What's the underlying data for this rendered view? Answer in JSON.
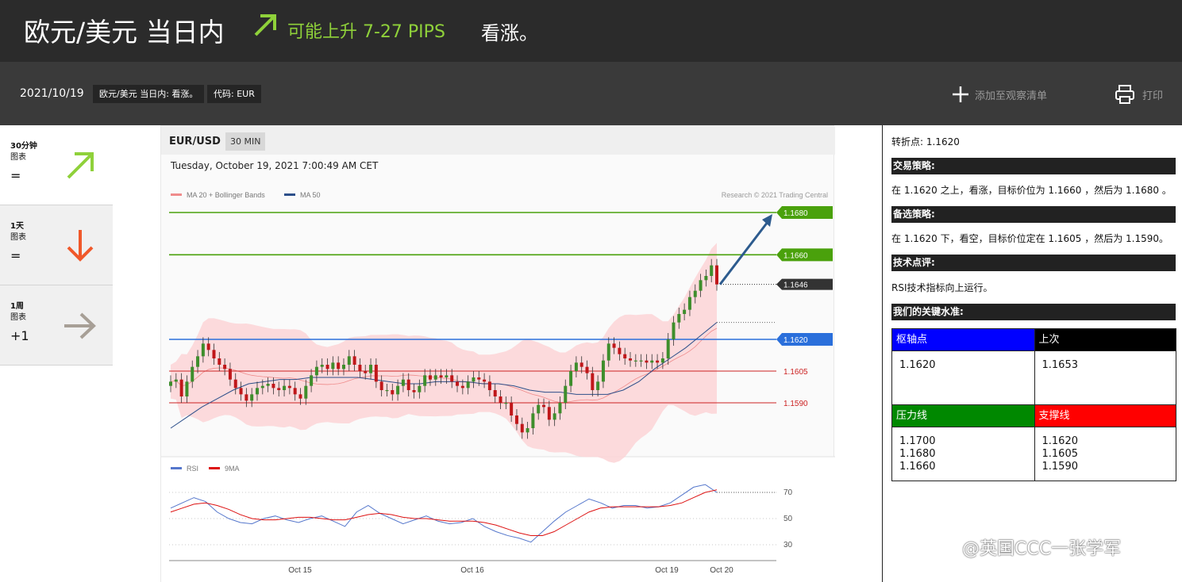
{
  "header": {
    "title": "欧元/美元 当日内",
    "forecast": "可能上升 7-27 PIPS",
    "bias": "看涨。",
    "arrow_color": "#8fd13a",
    "icon": "trend-up-arrow-icon"
  },
  "subheader": {
    "date": "2021/10/19",
    "tags": [
      "欧元/美元 当日内: 看涨。",
      "代码: EUR"
    ],
    "watchlist_label": "添加至观察清单",
    "print_label": "打印"
  },
  "timeframes": [
    {
      "label": "30分钟",
      "sublabel": "图表",
      "signal": "=",
      "direction": "up",
      "color": "#8fd13a"
    },
    {
      "label": "1天",
      "sublabel": "图表",
      "signal": "=",
      "direction": "down",
      "color": "#f0582a"
    },
    {
      "label": "1周",
      "sublabel": "图表",
      "signal": "+1",
      "direction": "right",
      "color": "#a79f96"
    }
  ],
  "chart": {
    "pair": "EUR/USD",
    "timeframe": "30 MIN",
    "timestamp": "Tuesday, October 19, 2021 7:00:49 AM CET",
    "legend_main": [
      "MA 20 + Bollinger Bands",
      "MA 50"
    ],
    "credit": "Research © 2021 Trading Central",
    "legend_rsi": [
      "RSI",
      "9MA"
    ],
    "date_labels": [
      "Oct 15",
      "Oct 16",
      "Oct 19",
      "Oct 20"
    ],
    "rsi_levels": [
      "70",
      "50",
      "30"
    ]
  },
  "chart_data": {
    "type": "candlestick",
    "instrument": "EUR/USD",
    "levels": [
      {
        "value": 1.168,
        "label": "1.1680",
        "kind": "target",
        "color": "#4aa10c"
      },
      {
        "value": 1.166,
        "label": "1.1660",
        "kind": "target",
        "color": "#4aa10c"
      },
      {
        "value": 1.1646,
        "label": "1.1646",
        "kind": "last",
        "color": "#333333"
      },
      {
        "value": 1.162,
        "label": "1.1620",
        "kind": "pivot",
        "color": "#2a6fdb"
      },
      {
        "value": 1.1605,
        "label": "1.1605",
        "kind": "support",
        "color": "#cc2222"
      },
      {
        "value": 1.159,
        "label": "1.1590",
        "kind": "support",
        "color": "#cc2222"
      }
    ],
    "ylim": [
      1.1565,
      1.1685
    ],
    "closes": [
      1.16,
      1.1601,
      1.1593,
      1.16,
      1.1607,
      1.1612,
      1.1618,
      1.1615,
      1.1611,
      1.1608,
      1.1606,
      1.1601,
      1.1597,
      1.1594,
      1.1591,
      1.1594,
      1.1597,
      1.1598,
      1.1599,
      1.1597,
      1.1596,
      1.1598,
      1.1597,
      1.1594,
      1.1592,
      1.1598,
      1.1603,
      1.1607,
      1.1608,
      1.1606,
      1.1609,
      1.1606,
      1.1608,
      1.1612,
      1.1608,
      1.1605,
      1.1604,
      1.1608,
      1.16,
      1.1596,
      1.1596,
      1.1594,
      1.1598,
      1.1601,
      1.1596,
      1.1595,
      1.1598,
      1.1603,
      1.1601,
      1.1603,
      1.1602,
      1.1603,
      1.16,
      1.1598,
      1.1597,
      1.16,
      1.1602,
      1.1601,
      1.16,
      1.1596,
      1.1593,
      1.159,
      1.159,
      1.1584,
      1.158,
      1.1576,
      1.1578,
      1.1585,
      1.1589,
      1.1588,
      1.1582,
      1.1585,
      1.159,
      1.1598,
      1.1605,
      1.1609,
      1.1607,
      1.1604,
      1.1596,
      1.16,
      1.161,
      1.1618,
      1.1616,
      1.1613,
      1.1611,
      1.161,
      1.161,
      1.161,
      1.1609,
      1.161,
      1.1609,
      1.1611,
      1.162,
      1.1628,
      1.1632,
      1.1634,
      1.164,
      1.1643,
      1.1648,
      1.165,
      1.1655,
      1.1646
    ],
    "ma50": [
      1.1578,
      1.1583,
      1.1588,
      1.1592,
      1.1596,
      1.1599,
      1.16,
      1.1601,
      1.1601,
      1.1602,
      1.1602,
      1.1602,
      1.1602,
      1.1601,
      1.16,
      1.1599,
      1.1599,
      1.16,
      1.16,
      1.16,
      1.1599,
      1.1599,
      1.1598,
      1.1596,
      1.1595,
      1.1595,
      1.1594,
      1.1594,
      1.1594,
      1.1596,
      1.16,
      1.1606,
      1.1611,
      1.1616,
      1.1622,
      1.1628
    ],
    "rsi": [
      58,
      62,
      66,
      63,
      55,
      50,
      47,
      46,
      50,
      52,
      49,
      47,
      50,
      52,
      48,
      44,
      55,
      60,
      54,
      50,
      46,
      49,
      52,
      48,
      46,
      47,
      50,
      44,
      40,
      37,
      35,
      32,
      40,
      48,
      55,
      60,
      65,
      62,
      58,
      60,
      60,
      58,
      59,
      62,
      68,
      74,
      76,
      70
    ],
    "rsi_ma": [
      55,
      58,
      61,
      62,
      60,
      57,
      53,
      50,
      49,
      49,
      50,
      51,
      51,
      50,
      49,
      49,
      51,
      53,
      54,
      53,
      51,
      50,
      50,
      49,
      48,
      48,
      48,
      47,
      45,
      42,
      39,
      37,
      37,
      40,
      45,
      50,
      55,
      58,
      59,
      59,
      59,
      59,
      59,
      60,
      62,
      66,
      70,
      72
    ],
    "target_arrow_to": 1.168
  },
  "right_panel": {
    "pivot_line": "转折点: 1.1620",
    "strategy_title": "交易策略:",
    "strategy_text": "在 1.1620 之上，看涨，目标价位为 1.1660 ，然后为 1.1680 。",
    "alt_title": "备选策略:",
    "alt_text": "在 1.1620 下，看空，目标价位定在 1.1605 ，然后为 1.1590。",
    "comment_title": "技术点评:",
    "comment_text": "RSI技术指标向上运行。",
    "levels_title": "我们的关键水准:",
    "table": {
      "pivot_header": "枢轴点",
      "last_header": "上次",
      "pivot_value": "1.1620",
      "last_value": "1.1653",
      "resistance_header": "压力线",
      "support_header": "支撑线",
      "resistance_values": [
        "1.1700",
        "1.1680",
        "1.1660"
      ],
      "support_values": [
        "1.1620",
        "1.1605",
        "1.1590"
      ],
      "colors": {
        "pivot": "#0000ff",
        "last": "#000000",
        "resistance": "#008800",
        "support": "#ff0000"
      }
    }
  },
  "watermark": "@英国CCC一张学军"
}
